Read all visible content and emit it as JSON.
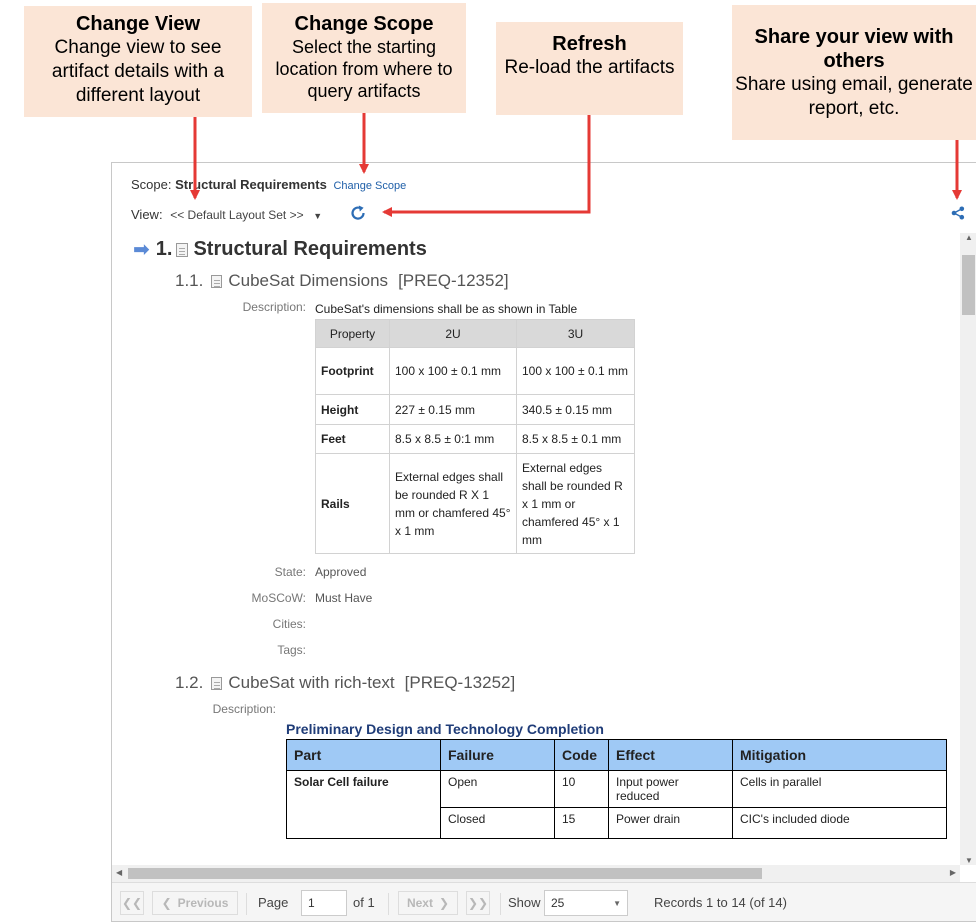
{
  "callouts": {
    "change_view": {
      "title": "Change View",
      "body": "Change view to see artifact details with a different layout"
    },
    "change_scope": {
      "title": "Change Scope",
      "body": "Select the starting location from where to query artifacts"
    },
    "refresh": {
      "title": "Refresh",
      "body": "Re-load the artifacts"
    },
    "share": {
      "title": "Share your view with others",
      "body": "Share using email, generate report, etc."
    }
  },
  "colors": {
    "callout_bg": "#fbe5d6",
    "arrow": "#e53935",
    "link": "#1f5fa8",
    "header_blue": "#9fc9f5"
  },
  "toolbar": {
    "scope_label": "Scope:",
    "scope_value": "Structural Requirements",
    "change_scope_link": "Change Scope",
    "view_label": "View:",
    "view_value": "<< Default Layout Set >>",
    "refresh_icon": "refresh-icon",
    "share_icon": "share-icon"
  },
  "doc": {
    "h1_num": "1.",
    "h1_title": "Structural Requirements",
    "item1": {
      "num": "1.1.",
      "title": "CubeSat Dimensions",
      "id": "[PREQ-12352]",
      "description_label": "Description:",
      "description_text": "CubeSat's dimensions shall be as shown in Table",
      "table": {
        "headers": [
          "Property",
          "2U",
          "3U"
        ],
        "rows": [
          {
            "name": "Footprint",
            "c2": "100 x 100 ± 0.1 mm",
            "c3": "100 x 100 ± 0.1 mm"
          },
          {
            "name": "Height",
            "c2": "227 ± 0.15 mm",
            "c3": "340.5 ± 0.15 mm"
          },
          {
            "name": "Feet",
            "c2": "8.5 x 8.5 ± 0:1 mm",
            "c3": "8.5 x 8.5 ± 0.1 mm"
          },
          {
            "name": "Rails",
            "c2": "External edges shall be rounded R X 1 mm or chamfered 45° x 1 mm",
            "c3": "External edges shall be rounded R x 1 mm or chamfered 45° x 1 mm"
          }
        ]
      },
      "fields": [
        {
          "label": "State:",
          "value": "Approved"
        },
        {
          "label": "MoSCoW:",
          "value": "Must Have"
        },
        {
          "label": "Cities:",
          "value": ""
        },
        {
          "label": "Tags:",
          "value": ""
        }
      ]
    },
    "item2": {
      "num": "1.2.",
      "title": "CubeSat with rich-text",
      "id": "[PREQ-13252]",
      "description_label": "Description:",
      "rt_title": "Preliminary Design and Technology Completion",
      "table": {
        "headers": [
          "Part",
          "Failure",
          "Code",
          "Effect",
          "Mitigation"
        ],
        "rows": [
          {
            "part": "Solar Cell failure",
            "failure": "Open",
            "code": "10",
            "effect": "Input power reduced",
            "mitigation": "Cells in parallel"
          },
          {
            "part": "",
            "failure": "Closed",
            "code": "15",
            "effect": "Power drain",
            "mitigation": "CIC's included diode"
          }
        ]
      }
    }
  },
  "pager": {
    "previous": "Previous",
    "page_label": "Page",
    "page_value": "1",
    "of_label": "of 1",
    "next": "Next",
    "show_label": "Show",
    "show_value": "25",
    "records": "Records 1 to 14 (of 14)"
  }
}
